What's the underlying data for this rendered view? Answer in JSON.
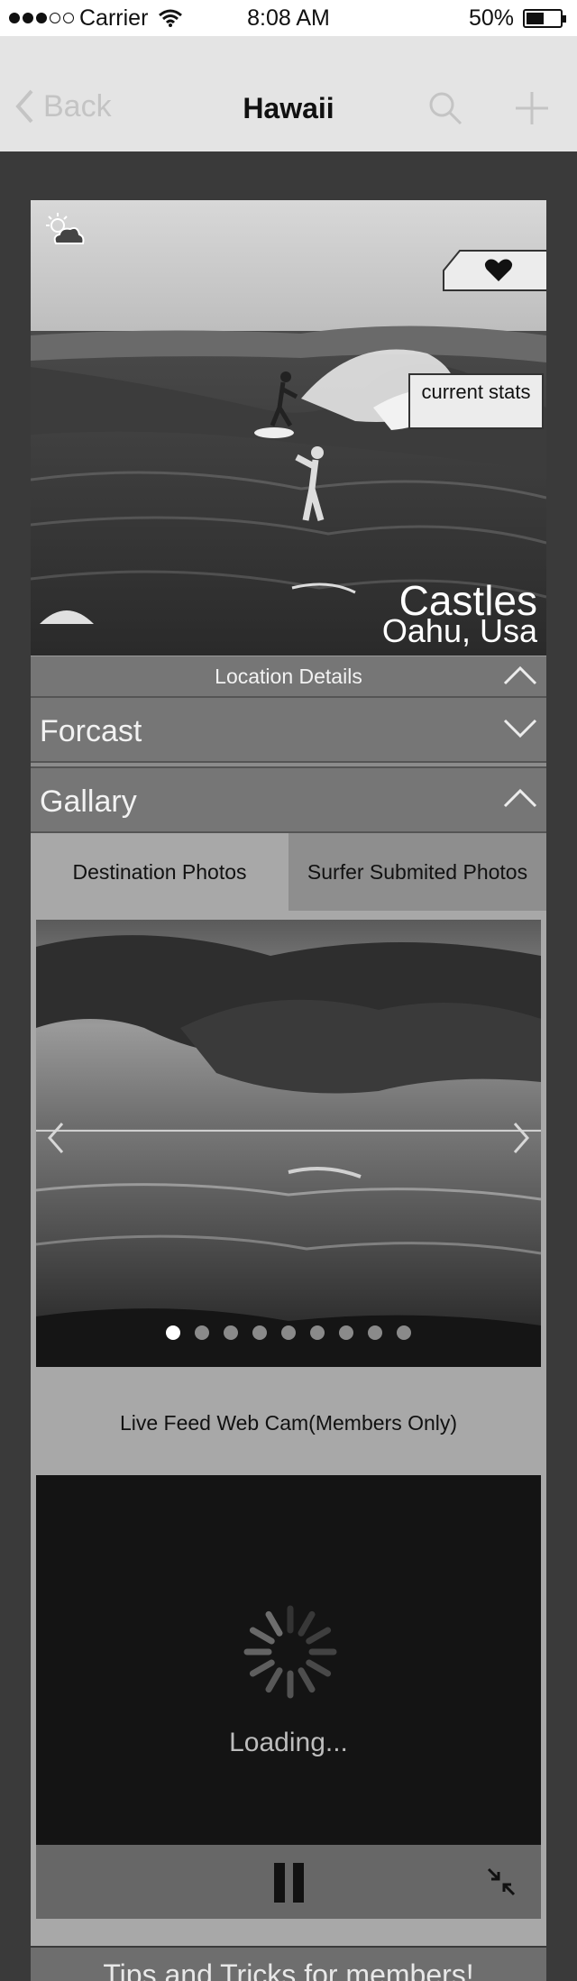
{
  "status_bar": {
    "carrier": "Carrier",
    "time": "8:08 AM",
    "battery": "50%",
    "battery_level": 0.5,
    "signal_bars_filled": 3,
    "signal_bars_total": 5
  },
  "nav": {
    "back_label": "Back",
    "title": "Hawaii",
    "icons": [
      "chevron-left-icon",
      "search-icon",
      "plus-icon"
    ]
  },
  "hero": {
    "weather_icon": "partly-cloudy-icon",
    "favorite_icon": "heart-icon",
    "stats_label": "current stats",
    "spot_name": "Castles",
    "spot_region": "Oahu, Usa"
  },
  "sections": {
    "location_details": "Location Details",
    "forecast": "Forcast",
    "gallery": "Gallary"
  },
  "gallery": {
    "tabs": [
      {
        "label": "Destination Photos",
        "active": true
      },
      {
        "label": "Surfer Submited Photos",
        "active": false
      }
    ],
    "slide_count": 9,
    "current_slide": 1
  },
  "webcam": {
    "title": "Live Feed Web Cam(Members Only)",
    "loading_text": "Loading...",
    "icons": [
      "pause-icon",
      "shrink-icon"
    ]
  },
  "tips": {
    "title": "Tips and Tricks for members!"
  },
  "colors": {
    "page_bg": "#3a3a3a",
    "nav_bg": "#e4e4e4",
    "section_bg": "#767676",
    "panel_bg": "#a8a8a8",
    "webcam_bg": "#141414"
  }
}
